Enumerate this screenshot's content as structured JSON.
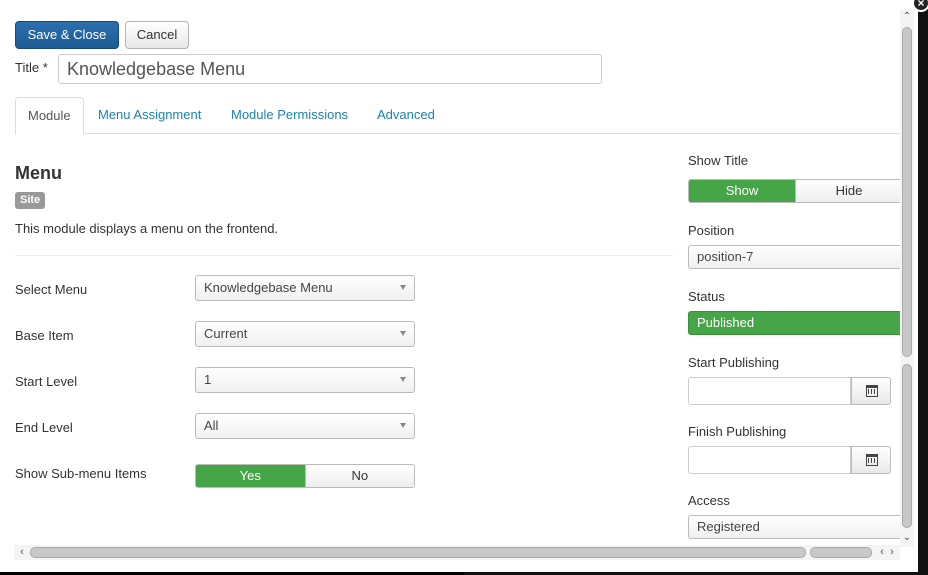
{
  "toolbar": {
    "save_close": "Save & Close",
    "cancel": "Cancel"
  },
  "title": {
    "label": "Title *",
    "value": "Knowledgebase Menu"
  },
  "tabs": [
    {
      "label": "Module"
    },
    {
      "label": "Menu Assignment"
    },
    {
      "label": "Module Permissions"
    },
    {
      "label": "Advanced"
    }
  ],
  "module": {
    "name": "Menu",
    "badge": "Site",
    "description": "This module displays a menu on the frontend."
  },
  "fields": {
    "select_menu": {
      "label": "Select Menu",
      "value": "Knowledgebase Menu"
    },
    "base_item": {
      "label": "Base Item",
      "value": "Current"
    },
    "start_level": {
      "label": "Start Level",
      "value": "1"
    },
    "end_level": {
      "label": "End Level",
      "value": "All"
    },
    "show_submenu": {
      "label": "Show Sub-menu Items",
      "yes": "Yes",
      "no": "No",
      "selected": "Yes"
    }
  },
  "sidebar": {
    "show_title": {
      "label": "Show Title",
      "show": "Show",
      "hide": "Hide",
      "selected": "Show"
    },
    "position": {
      "label": "Position",
      "value": "position-7"
    },
    "status": {
      "label": "Status",
      "value": "Published"
    },
    "start_publishing": {
      "label": "Start Publishing",
      "value": ""
    },
    "finish_publishing": {
      "label": "Finish Publishing",
      "value": ""
    },
    "access": {
      "label": "Access",
      "value": "Registered"
    }
  },
  "colors": {
    "primary": "#1d5b94",
    "success": "#46a546",
    "link": "#1f83a8"
  }
}
